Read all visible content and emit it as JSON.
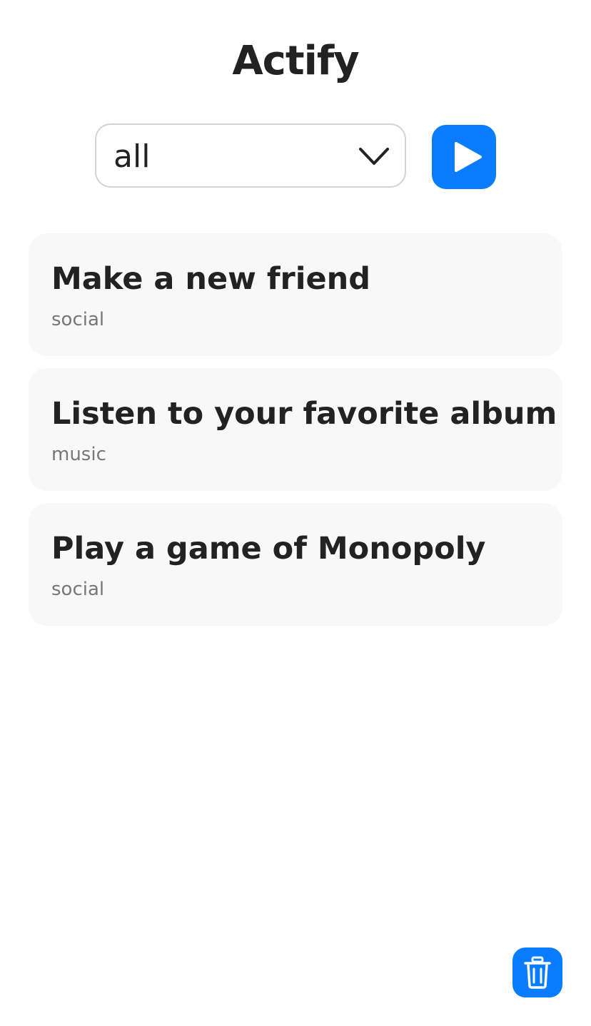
{
  "app": {
    "title": "Actify"
  },
  "filter": {
    "selected_value": "all",
    "dropdown_icon": "chevron-down-icon"
  },
  "play_button": {
    "icon": "play-icon",
    "color": "#0a7cff"
  },
  "activities": [
    {
      "title": "Make a new friend",
      "category": "social"
    },
    {
      "title": "Listen to your favorite album",
      "category": "music"
    },
    {
      "title": "Play a game of Monopoly",
      "category": "social"
    }
  ],
  "trash_button": {
    "icon": "trash-icon",
    "color": "#0a7cff"
  }
}
